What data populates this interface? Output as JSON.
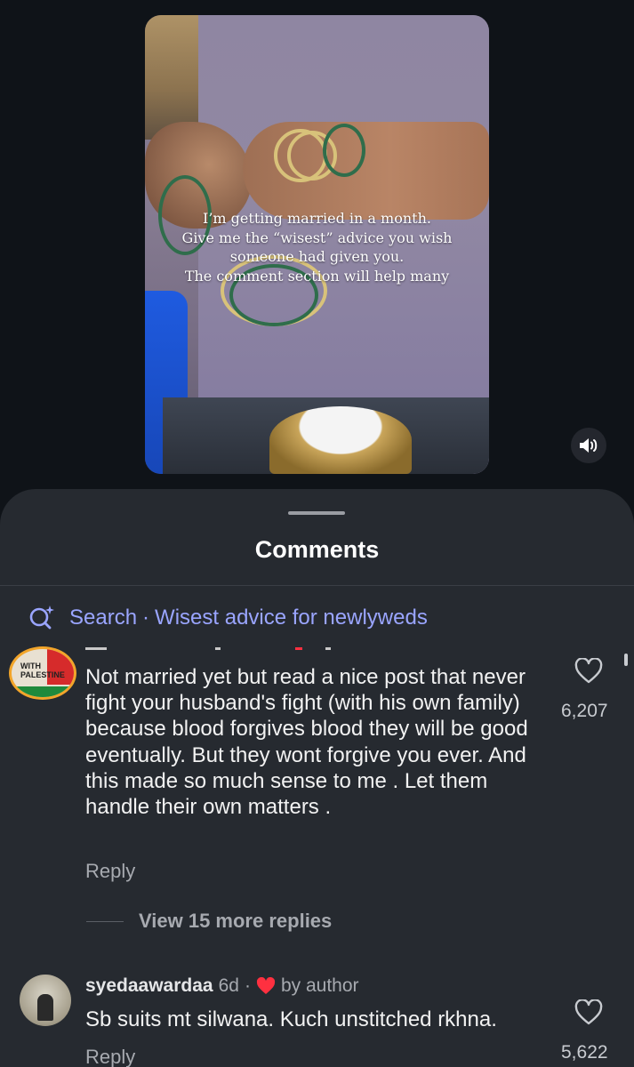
{
  "video": {
    "caption_lines": [
      "I’m getting married in a month.",
      "Give me the “wisest” advice you wish",
      "someone had given you.",
      "The comment section will help many"
    ],
    "mute_icon": "speaker-icon"
  },
  "sheet": {
    "title": "Comments",
    "search": {
      "prefix": "Search",
      "separator": "·",
      "query": "Wisest advice for newlyweds"
    }
  },
  "comments": [
    {
      "avatar_badge_text": "WITH PALESTINE",
      "text": "Not married yet but read a nice post that never fight your husband's fight (with his own family) because blood forgives blood they will be good eventually. But they wont forgive you ever. And this made so much sense to me . Let them handle their own matters .",
      "reply_label": "Reply",
      "like_count": "6,207",
      "view_replies": "View 15 more replies"
    },
    {
      "username": "syedaawardaa",
      "age": "6d",
      "separator": "·",
      "author_badge": "by author",
      "text": "Sb suits mt silwana. Kuch unstitched rkhna.",
      "reply_label": "Reply",
      "like_count": "5,622"
    }
  ],
  "colors": {
    "background": "#0f1318",
    "sheet": "#262a30",
    "search_accent": "#9aa5ff",
    "heart_red": "#ff3040",
    "muted_text": "#a7aab0"
  }
}
